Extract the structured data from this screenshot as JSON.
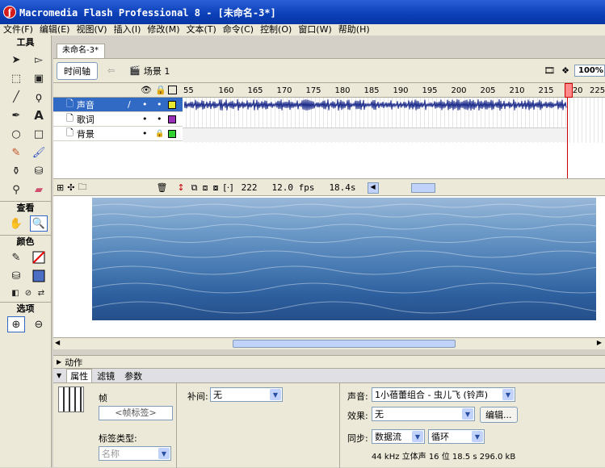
{
  "app_title": "Macromedia Flash Professional 8 - [未命名-3*]",
  "menu": [
    "文件(F)",
    "编辑(E)",
    "视图(V)",
    "插入(I)",
    "修改(M)",
    "文本(T)",
    "命令(C)",
    "控制(O)",
    "窗口(W)",
    "帮助(H)"
  ],
  "tools_panel": {
    "title": "工具",
    "view_label": "查看",
    "colors_label": "颜色",
    "options_label": "选项"
  },
  "document": {
    "tab": "未命名-3*",
    "timeline_button": "时间轴",
    "scene": "场景 1",
    "zoom": "100%"
  },
  "timeline": {
    "ruler": [
      "55",
      "160",
      "165",
      "170",
      "175",
      "180",
      "185",
      "190",
      "195",
      "200",
      "205",
      "210",
      "215",
      "220",
      "225"
    ],
    "layers": [
      {
        "name": "声音",
        "color": "#e8e830",
        "selected": true
      },
      {
        "name": "歌词",
        "color": "#9b30b8",
        "selected": false
      },
      {
        "name": "背景",
        "color": "#30d030",
        "selected": false
      }
    ],
    "current_frame": "222",
    "fps": "12.0 fps",
    "time": "18.4s"
  },
  "panels": {
    "actions_label": "动作",
    "tabs": [
      "属性",
      "滤镜",
      "参数"
    ],
    "frame_label": "帧",
    "frame_name_placeholder": "<帧标签>",
    "label_type": "标签类型:",
    "label_type_value": "名称",
    "tween_label": "补间:",
    "tween_value": "无",
    "sound_label": "声音:",
    "sound_value": "1小蓓蕾组合 - 虫儿飞 (铃声)",
    "effect_label": "效果:",
    "effect_value": "无",
    "edit_button": "编辑...",
    "sync_label": "同步:",
    "sync_value": "数据流",
    "loop_value": "循环",
    "sound_info": "44 kHz 立体声 16 位 18.5 s 296.0 kB"
  }
}
